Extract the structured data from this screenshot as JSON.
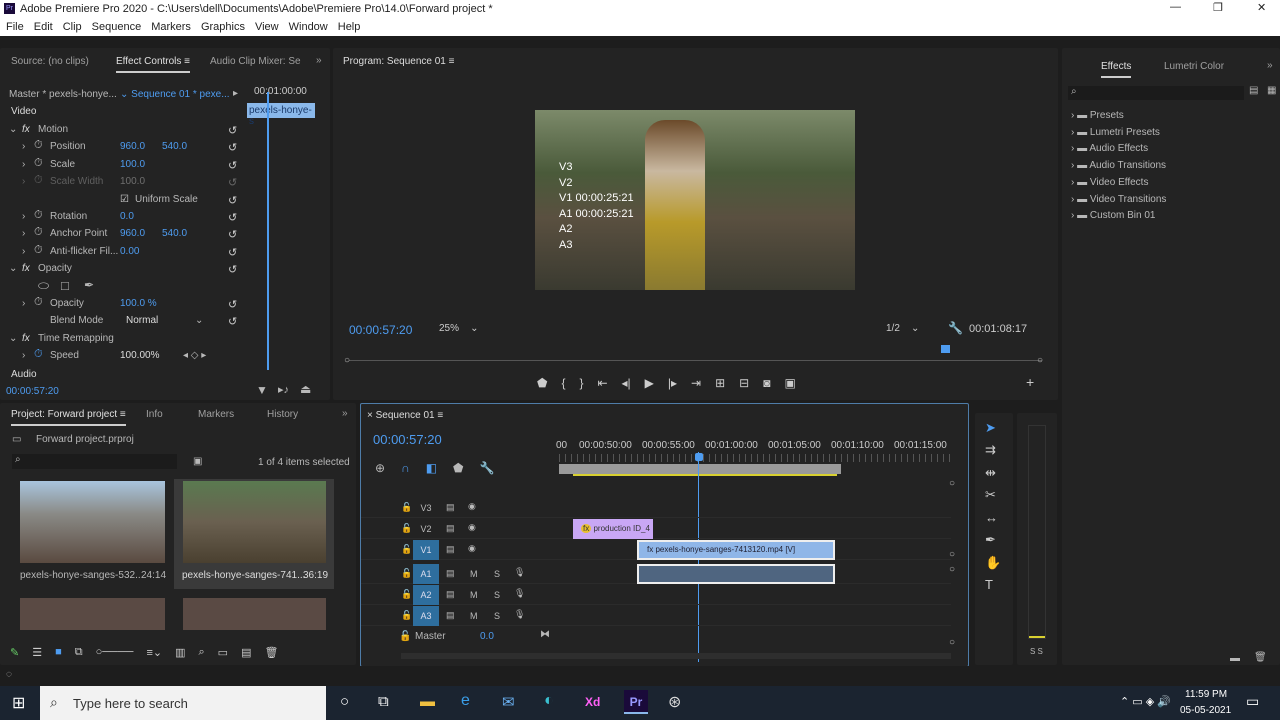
{
  "window": {
    "title": "Adobe Premiere Pro 2020 - C:\\Users\\dell\\Documents\\Adobe\\Premiere Pro\\14.0\\Forward project *",
    "app_badge": "Pr"
  },
  "menu": [
    "File",
    "Edit",
    "Clip",
    "Sequence",
    "Markers",
    "Graphics",
    "View",
    "Window",
    "Help"
  ],
  "effect_controls": {
    "tabs": [
      "Source: (no clips)",
      "Effect Controls",
      "Audio Clip Mixer: Se"
    ],
    "master": "Master * pexels-honye...",
    "sequence": "Sequence 01 * pexe...",
    "mini_time": "00:01:00:00",
    "mini_clip": "pexels-honye-s",
    "video_label": "Video",
    "audio_label": "Audio",
    "timecode": "00:00:57:20",
    "rows": [
      {
        "label": "Motion",
        "fx": true
      },
      {
        "label": "Position",
        "v1": "960.0",
        "v2": "540.0"
      },
      {
        "label": "Scale",
        "v1": "100.0"
      },
      {
        "label": "Scale Width",
        "v1": "100.0",
        "disabled": true
      },
      {
        "label": "",
        "check": "Uniform Scale"
      },
      {
        "label": "Rotation",
        "v1": "0.0"
      },
      {
        "label": "Anchor Point",
        "v1": "960.0",
        "v2": "540.0"
      },
      {
        "label": "Anti-flicker Fil...",
        "v1": "0.00"
      },
      {
        "label": "Opacity",
        "fx": true
      },
      {
        "label": "",
        "masks": true
      },
      {
        "label": "Opacity",
        "v1": "100.0 %"
      },
      {
        "label": "Blend Mode",
        "v1": "Normal"
      },
      {
        "label": "Time Remapping",
        "fx": true
      },
      {
        "label": "Speed",
        "v1": "100.00%"
      }
    ]
  },
  "program": {
    "tab": "Program: Sequence 01",
    "overlay": [
      "V3",
      "V2",
      "V1 00:00:25:21",
      "A1 00:00:25:21",
      "A2",
      "A3"
    ],
    "timecode": "00:00:57:20",
    "zoom": "25%",
    "resolution": "1/2",
    "duration": "00:01:08:17",
    "playhead_fraction": 0.86
  },
  "effects": {
    "tabs": [
      "Effects",
      "Lumetri Color"
    ],
    "items": [
      "Presets",
      "Lumetri Presets",
      "Audio Effects",
      "Audio Transitions",
      "Video Effects",
      "Video Transitions",
      "Custom Bin 01"
    ]
  },
  "project": {
    "tabs": [
      "Project: Forward project",
      "Info",
      "Markers",
      "History"
    ],
    "file": "Forward project.prproj",
    "selection": "1 of 4 items selected",
    "items": [
      {
        "name": "pexels-honye-sanges-532...",
        "duration": "24:14"
      },
      {
        "name": "pexels-honye-sanges-741...",
        "duration": "36:19"
      }
    ]
  },
  "timeline": {
    "tab": "Sequence 01",
    "timecode": "00:00:57:20",
    "ruler": [
      "00",
      "00:00:50:00",
      "00:00:55:00",
      "00:01:00:00",
      "00:01:05:00",
      "00:01:10:00",
      "00:01:15:00"
    ],
    "tracks": [
      {
        "name": "V3",
        "type": "v"
      },
      {
        "name": "V2",
        "type": "v"
      },
      {
        "name": "V1",
        "type": "v",
        "target": true
      },
      {
        "name": "A1",
        "type": "a",
        "target": true
      },
      {
        "name": "A2",
        "type": "a",
        "target": true
      },
      {
        "name": "A3",
        "type": "a",
        "target": true
      }
    ],
    "master": "Master",
    "master_val": "0.0",
    "m": "M",
    "s": "S",
    "clips": {
      "v2": "production ID_4",
      "v1": "pexels-honye-sanges-7413120.mp4 [V]"
    }
  },
  "meter": {
    "labels": "S S"
  },
  "taskbar": {
    "search": "Type here to search",
    "time": "11:59 PM",
    "date": "05-05-2021"
  },
  "colors": {
    "accent": "#4e9cf0",
    "v2clip": "#c9a7f5",
    "v1clip": "#8fb6e8",
    "audio_clip": "#4f6580"
  }
}
